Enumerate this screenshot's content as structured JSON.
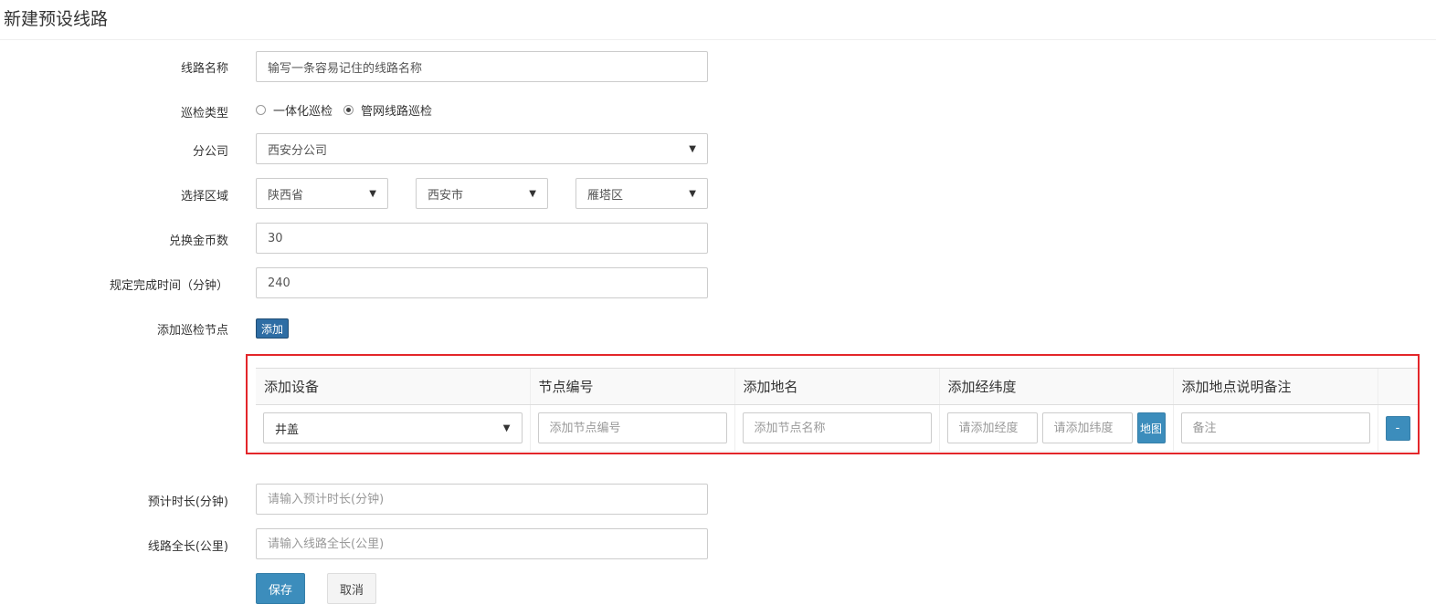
{
  "page": {
    "title": "新建预设线路"
  },
  "form": {
    "route_name": {
      "label": "线路名称",
      "value": "输写一条容易记住的线路名称"
    },
    "patrol_type": {
      "label": "巡检类型",
      "options": [
        {
          "label": "一体化巡检",
          "checked": false
        },
        {
          "label": "管网线路巡检",
          "checked": true
        }
      ]
    },
    "branch": {
      "label": "分公司",
      "selected": "西安分公司"
    },
    "region": {
      "label": "选择区域",
      "province": "陕西省",
      "city": "西安市",
      "district": "雁塔区"
    },
    "coins": {
      "label": "兑换金币数",
      "value": "30"
    },
    "time_limit": {
      "label": "规定完成时间（分钟）",
      "value": "240"
    },
    "nodes": {
      "label": "添加巡检节点",
      "add_button": "添加",
      "headers": [
        "添加设备",
        "节点编号",
        "添加地名",
        "添加经纬度",
        "添加地点说明备注"
      ],
      "rows": [
        {
          "device": "井盖",
          "node_no_placeholder": "添加节点编号",
          "place_placeholder": "添加节点名称",
          "lng_placeholder": "请添加经度",
          "lat_placeholder": "请添加纬度",
          "map_button": "地图",
          "note_placeholder": "备注",
          "remove_button": "-"
        }
      ]
    },
    "est_duration": {
      "label": "预计时长(分钟)",
      "placeholder": "请输入预计时长(分钟)"
    },
    "route_length": {
      "label": "线路全长(公里)",
      "placeholder": "请输入线路全长(公里)"
    },
    "save_button": "保存",
    "cancel_button": "取消"
  }
}
